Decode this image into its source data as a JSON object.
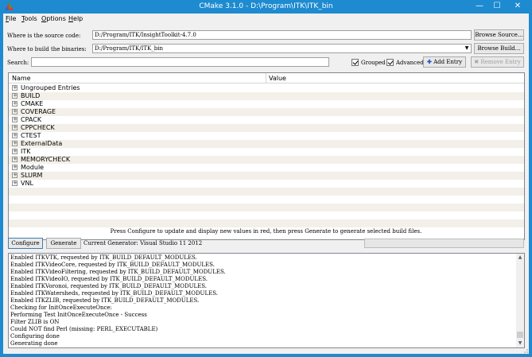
{
  "window": {
    "title": "CMake 3.1.0 - D:\\Program\\ITK\\ITK_bin",
    "minimize": "—",
    "maximize": "☐",
    "close": "✕"
  },
  "menu": [
    {
      "accel": "F",
      "rest": "ile"
    },
    {
      "accel": "T",
      "rest": "ools"
    },
    {
      "accel": "O",
      "rest": "ptions"
    },
    {
      "accel": "H",
      "rest": "elp"
    }
  ],
  "source": {
    "label": "Where is the source code:",
    "value": "D:/Program/ITK/InsightToolkit-4.7.0",
    "browse_label": "Browse Source..."
  },
  "build": {
    "label": "Where to build the binaries:",
    "value": "D:/Program/ITK/ITK_bin",
    "browse_label": "Browse Build..."
  },
  "search": {
    "label": "Search:",
    "value": ""
  },
  "options": {
    "grouped_label": "Grouped",
    "advanced_label": "Advanced",
    "add_entry_label": "Add Entry",
    "remove_entry_label": "Remove Entry"
  },
  "tree": {
    "col_name": "Name",
    "col_value": "Value",
    "groups": [
      "Ungrouped Entries",
      "BUILD",
      "CMAKE",
      "COVERAGE",
      "CPACK",
      "CPPCHECK",
      "CTEST",
      "ExternalData",
      "ITK",
      "MEMORYCHECK",
      "Module",
      "SLURM",
      "VNL"
    ]
  },
  "hint": "Press Configure to update and display new values in red, then press Generate to generate selected build files.",
  "actions": {
    "configure_label": "Configure",
    "generate_label": "Generate",
    "generator_text": "Current Generator: Visual Studio 11 2012"
  },
  "output": [
    "Enabled ITKVTK, requested by ITK_BUILD_DEFAULT_MODULES.",
    "Enabled ITKVideoCore, requested by ITK_BUILD_DEFAULT_MODULES.",
    "Enabled ITKVideoFiltering, requested by ITK_BUILD_DEFAULT_MODULES.",
    "Enabled ITKVideoIO, requested by ITK_BUILD_DEFAULT_MODULES.",
    "Enabled ITKVoronoi, requested by ITK_BUILD_DEFAULT_MODULES.",
    "Enabled ITKWatersheds, requested by ITK_BUILD_DEFAULT_MODULES.",
    "Enabled ITKZLIB, requested by ITK_BUILD_DEFAULT_MODULES.",
    "Checking for InitOnceExecuteOnce:",
    "Performing Test InitOnceExecuteOnce - Success",
    "Filter ZLIB is ON",
    "Could NOT find Perl (missing:  PERL_EXECUTABLE)",
    "Configuring done",
    "Generating done"
  ],
  "colors": {
    "titlebar": "#1e8bd0",
    "client": "#f0f0f0",
    "alt_row": "#f2f0e8"
  }
}
